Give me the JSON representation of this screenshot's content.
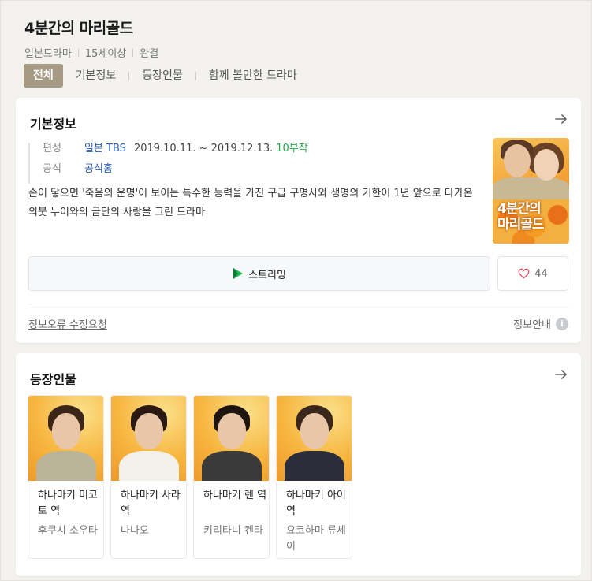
{
  "header": {
    "title": "4분간의 마리골드",
    "meta": [
      "일본드라마",
      "15세이상",
      "완결"
    ]
  },
  "tabs": [
    {
      "label": "전체",
      "active": true
    },
    {
      "label": "기본정보",
      "active": false
    },
    {
      "label": "등장인물",
      "active": false
    },
    {
      "label": "함께 볼만한 드라마",
      "active": false
    }
  ],
  "basic_info": {
    "title": "기본정보",
    "broadcast_label": "편성",
    "broadcast_network": "일본 TBS",
    "broadcast_dates": "2019.10.11. ~ 2019.12.13.",
    "episodes": "10부작",
    "official_label": "공식",
    "official_link": "공식홈",
    "description": "손이 닿으면 '죽음의 운명'이 보이는 특수한 능력을 가진 구급 구명사와 생명의 기한이 1년 앞으로 다가온 의붓 누이와의 금단의 사랑을 그린 드라마",
    "poster_logo_line1": "4분간의",
    "poster_logo_line2": "마리골드",
    "streaming_label": "스트리밍",
    "like_count": "44",
    "report_link": "정보오류 수정요청",
    "guide_label": "정보안내",
    "guide_icon_glyph": "i"
  },
  "cast": {
    "title": "등장인물",
    "members": [
      {
        "role": "하나마키 미코토 역",
        "actor": "후쿠시 소우타",
        "hair": "#3b2618",
        "body": "#b9b49a"
      },
      {
        "role": "하나마키 사라 역",
        "actor": "나나오",
        "hair": "#2a1a12",
        "body": "#f4f1ea"
      },
      {
        "role": "하나마키 렌 역",
        "actor": "키리타니 켄타",
        "hair": "#1e1510",
        "body": "#3a3a3a"
      },
      {
        "role": "하나마키 아이 역",
        "actor": "요코하마 류세이",
        "hair": "#3a261a",
        "body": "#2b2d3a"
      }
    ]
  },
  "colors": {
    "accent_tab": "#a79a84",
    "link_blue": "#2b5fb3",
    "episodes_green": "#2aa44a",
    "heart_red": "#e04a5a"
  },
  "icons": {
    "arrow": "arrow-right-icon",
    "streaming": "play-logo-icon",
    "like": "heart-icon",
    "info": "info-circle-icon"
  }
}
